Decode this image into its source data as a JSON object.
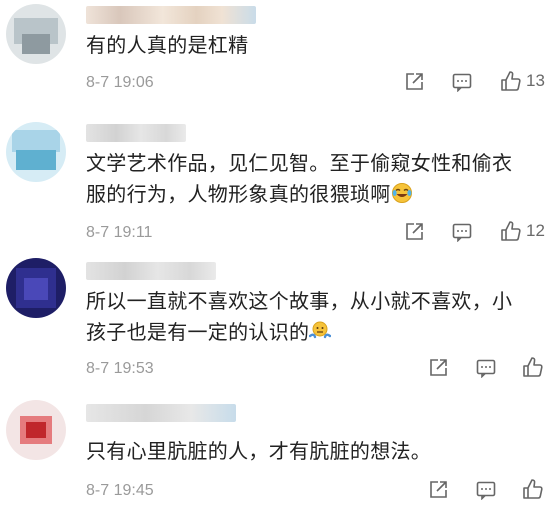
{
  "comments": [
    {
      "text": "有的人真的是杠精",
      "time": "8-7 19:06",
      "likes": "13",
      "avatar_colors": [
        "#b9c4c9",
        "#8e9aa0",
        "#dfe4e6"
      ]
    },
    {
      "text": "文学艺术作品，见仁见智。至于偷窥女性和偷衣服的行为，人物形象真的很猥琐啊",
      "time": "8-7 19:11",
      "likes": "12",
      "avatar_colors": [
        "#a9d4e8",
        "#5fb0d0",
        "#d6ecf5"
      ]
    },
    {
      "text": "所以一直就不喜欢这个故事，从小就不喜欢，小孩子也是有一定的认识的",
      "time": "8-7 19:53",
      "likes": "",
      "avatar_colors": [
        "#2f2f8f",
        "#4a48b8",
        "#1e1e66"
      ]
    },
    {
      "text": "只有心里肮脏的人，才有肮脏的想法。",
      "time": "8-7 19:45",
      "likes": "",
      "avatar_colors": [
        "#c0262b",
        "#e57b7e",
        "#f3e5e5"
      ]
    }
  ],
  "icons": {
    "share": "share-icon",
    "reply": "comment-icon",
    "like": "thumbs-up-icon",
    "laugh": "tears-of-joy-emoji",
    "shrug": "shrug-emoji"
  },
  "colors": {
    "text": "#222222",
    "meta": "#9a9a9a",
    "icon": "#666666",
    "emoji": "#f6c33a"
  }
}
